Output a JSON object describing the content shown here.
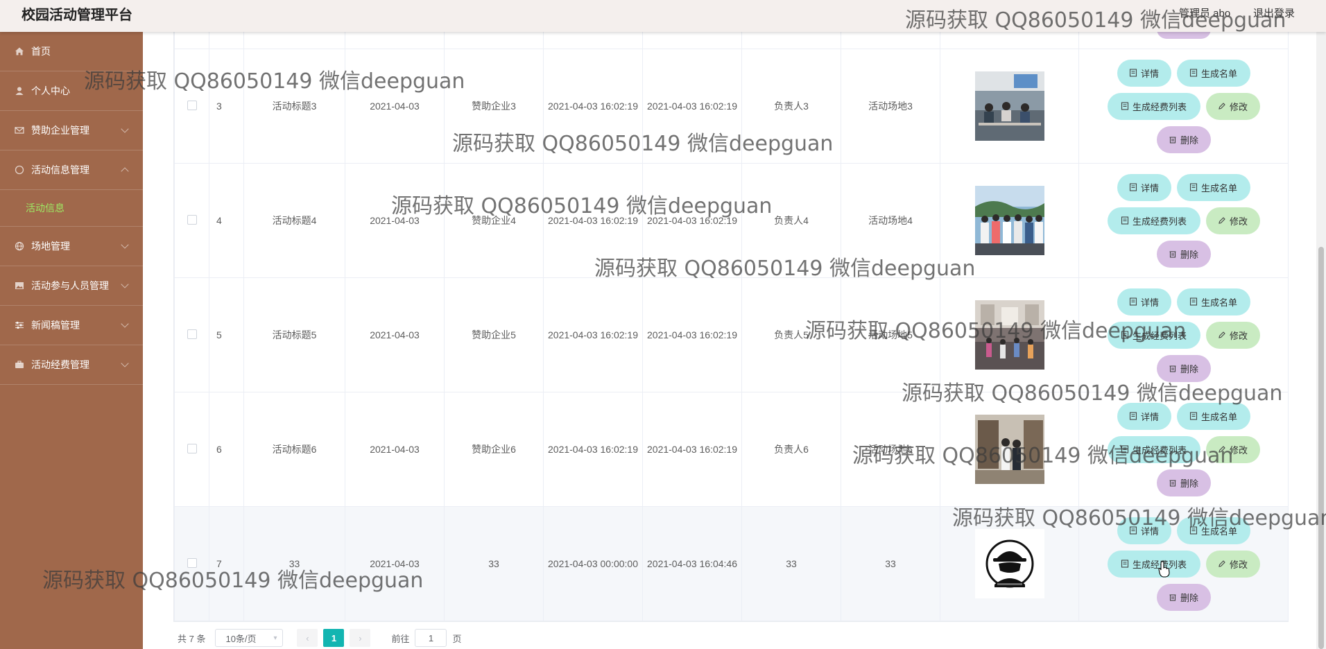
{
  "header": {
    "app_title": "校园活动管理平台",
    "admin_label": "管理员 abo",
    "logout": "退出登录"
  },
  "sidebar": {
    "items": [
      {
        "label": "首页",
        "icon": "home-icon"
      },
      {
        "label": "个人中心",
        "icon": "user-icon"
      },
      {
        "label": "赞助企业管理",
        "icon": "mail-icon",
        "expandable": true
      },
      {
        "label": "活动信息管理",
        "icon": "compass-icon",
        "expandable": true,
        "expanded": true
      },
      {
        "label": "场地管理",
        "icon": "globe-icon",
        "expandable": true
      },
      {
        "label": "活动参与人员管理",
        "icon": "image-icon",
        "expandable": true
      },
      {
        "label": "新闻稿管理",
        "icon": "sliders-icon",
        "expandable": true
      },
      {
        "label": "活动经费管理",
        "icon": "briefcase-icon",
        "expandable": true
      }
    ],
    "active_submenu": "活动信息"
  },
  "table": {
    "rows": [
      {
        "index": "3",
        "title": "活动标题3",
        "date": "2021-04-03",
        "sponsor": "赞助企业3",
        "start": "2021-04-03 16:02:19",
        "end": "2021-04-03 16:02:19",
        "manager": "负责人3",
        "venue": "活动场地3",
        "image": "classroom-photo"
      },
      {
        "index": "4",
        "title": "活动标题4",
        "date": "2021-04-03",
        "sponsor": "赞助企业4",
        "start": "2021-04-03 16:02:19",
        "end": "2021-04-03 16:02:19",
        "manager": "负责人4",
        "venue": "活动场地4",
        "image": "group-photo"
      },
      {
        "index": "5",
        "title": "活动标题5",
        "date": "2021-04-03",
        "sponsor": "赞助企业5",
        "start": "2021-04-03 16:02:19",
        "end": "2021-04-03 16:02:19",
        "manager": "负责人5",
        "venue": "活动场地5",
        "image": "hall-photo"
      },
      {
        "index": "6",
        "title": "活动标题6",
        "date": "2021-04-03",
        "sponsor": "赞助企业6",
        "start": "2021-04-03 16:02:19",
        "end": "2021-04-03 16:02:19",
        "manager": "负责人6",
        "venue": "活动场地6",
        "image": "library-photo"
      },
      {
        "index": "7",
        "title": "33",
        "date": "2021-04-03",
        "sponsor": "33",
        "start": "2021-04-03 00:00:00",
        "end": "2021-04-03 16:04:46",
        "manager": "33",
        "venue": "33",
        "image": "hacker-logo"
      }
    ],
    "buttons": {
      "detail": "详情",
      "list": "生成名单",
      "fee": "生成经费列表",
      "edit": "修改",
      "delete": "删除"
    }
  },
  "pagination": {
    "total": "共 7 条",
    "page_size": "10条/页",
    "current_page": "1",
    "goto_prefix": "前往",
    "goto_value": "1",
    "goto_suffix": "页"
  },
  "watermarks": [
    "源码获取 QQ86050149 微信deepguan",
    "源码获取 QQ86050149 微信deepguan",
    "源码获取 QQ86050149 微信deepguan",
    "源码获取 QQ86050149 微信deepguan",
    "源码获取 QQ86050149 微信deepguan",
    "源码获取 QQ86050149 微信deepguan",
    "源码获取 QQ86050149 微信deepguan",
    "源码获取 QQ86050149 微信deepguan",
    "源码获取 QQ86050149 微信deepguan",
    "源码获取 QQ86050149 微信deepguan"
  ],
  "colors": {
    "sidebar": "#a0684b",
    "accent": "#13b5b1",
    "submenu_active": "#9eea64"
  }
}
